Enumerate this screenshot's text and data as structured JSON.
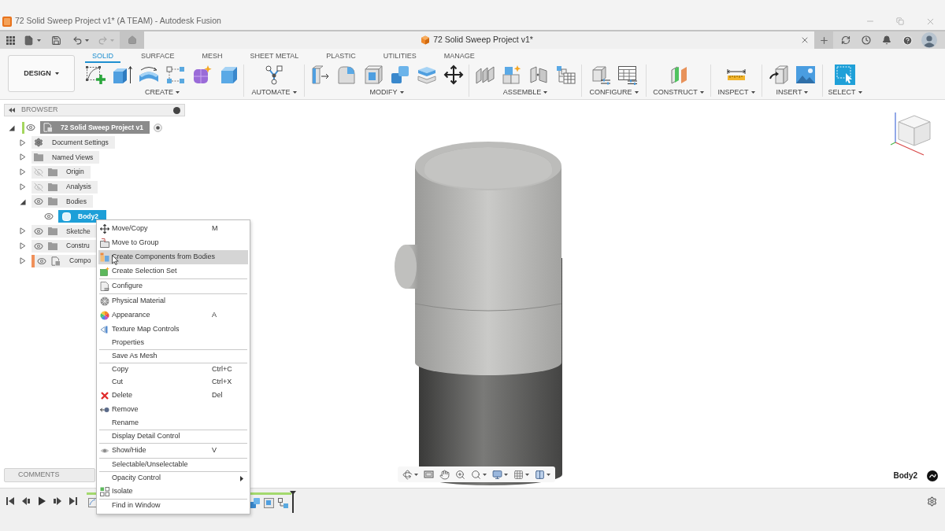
{
  "window": {
    "title": "72 Solid Sweep Project v1* (A TEAM) - Autodesk Fusion"
  },
  "quick_access": {
    "undo_disabled": false,
    "redo_disabled": true
  },
  "document_tab": {
    "title": "72 Solid Sweep Project v1*"
  },
  "toolbar": {
    "workspace": "DESIGN",
    "tabs": [
      {
        "label": "SOLID",
        "selected": true
      },
      {
        "label": "SURFACE",
        "selected": false
      },
      {
        "label": "MESH",
        "selected": false
      },
      {
        "label": "SHEET METAL",
        "selected": false
      },
      {
        "label": "PLASTIC",
        "selected": false
      },
      {
        "label": "UTILITIES",
        "selected": false
      },
      {
        "label": "MANAGE",
        "selected": false
      }
    ],
    "groups": [
      {
        "label": "CREATE"
      },
      {
        "label": "AUTOMATE"
      },
      {
        "label": "MODIFY"
      },
      {
        "label": "ASSEMBLE"
      },
      {
        "label": "CONFIGURE"
      },
      {
        "label": "CONSTRUCT"
      },
      {
        "label": "INSPECT"
      },
      {
        "label": "INSERT"
      },
      {
        "label": "SELECT"
      }
    ]
  },
  "browser": {
    "title": "BROWSER",
    "tree": [
      {
        "label": "72 Solid Sweep Project v1",
        "kind": "root",
        "visible": true,
        "expanded": true,
        "selected": false,
        "color": "#a4d65e",
        "children": [
          {
            "label": "Document Settings",
            "kind": "settings",
            "expanded": false,
            "selected": false
          },
          {
            "label": "Named Views",
            "kind": "folder",
            "expanded": false,
            "selected": false
          },
          {
            "label": "Origin",
            "kind": "folder",
            "visible": false,
            "expanded": false,
            "selected": false
          },
          {
            "label": "Analysis",
            "kind": "folder",
            "visible": false,
            "expanded": false,
            "selected": false
          },
          {
            "label": "Bodies",
            "kind": "folder",
            "visible": true,
            "expanded": true,
            "selected": false,
            "children": [
              {
                "label": "Body2",
                "kind": "body",
                "visible": true,
                "selected": true
              }
            ]
          },
          {
            "label": "Sketche",
            "kind": "folder",
            "visible": true,
            "expanded": false,
            "selected": false
          },
          {
            "label": "Constru",
            "kind": "folder",
            "visible": true,
            "expanded": false,
            "selected": false
          },
          {
            "label": "Compo",
            "kind": "component",
            "visible": true,
            "expanded": false,
            "selected": false,
            "color": "#f0905a"
          }
        ]
      }
    ]
  },
  "context_menu": {
    "sections": [
      [
        {
          "label": "Move/Copy",
          "shortcut": "M",
          "selected": false,
          "submenu": false
        },
        {
          "label": "Move to Group",
          "selected": false,
          "submenu": false
        },
        {
          "label": "Create Components from Bodies",
          "selected": true,
          "submenu": false
        },
        {
          "label": "Create Selection Set",
          "selected": false,
          "submenu": false
        }
      ],
      [
        {
          "label": "Configure",
          "selected": false,
          "submenu": false
        }
      ],
      [
        {
          "label": "Physical Material",
          "selected": false,
          "submenu": false
        },
        {
          "label": "Appearance",
          "shortcut": "A",
          "selected": false,
          "submenu": false
        },
        {
          "label": "Texture Map Controls",
          "selected": false,
          "submenu": false
        },
        {
          "label": "Properties",
          "selected": false,
          "submenu": false
        }
      ],
      [
        {
          "label": "Save As Mesh",
          "selected": false,
          "submenu": false
        }
      ],
      [
        {
          "label": "Copy",
          "shortcut": "Ctrl+C",
          "selected": false,
          "submenu": false
        },
        {
          "label": "Cut",
          "shortcut": "Ctrl+X",
          "selected": false,
          "submenu": false
        },
        {
          "label": "Delete",
          "shortcut": "Del",
          "selected": false,
          "submenu": false
        },
        {
          "label": "Remove",
          "selected": false,
          "submenu": false
        },
        {
          "label": "Rename",
          "selected": false,
          "submenu": false
        }
      ],
      [
        {
          "label": "Display Detail Control",
          "selected": false,
          "submenu": false
        }
      ],
      [
        {
          "label": "Show/Hide",
          "shortcut": "V",
          "selected": false,
          "submenu": false
        }
      ],
      [
        {
          "label": "Selectable/Unselectable",
          "selected": false,
          "submenu": false
        }
      ],
      [
        {
          "label": "Opacity Control",
          "selected": false,
          "submenu": true
        },
        {
          "label": "Isolate",
          "selected": false,
          "submenu": false
        }
      ],
      [
        {
          "label": "Find in Window",
          "selected": false,
          "submenu": false
        }
      ]
    ]
  },
  "comments": {
    "title": "COMMENTS"
  },
  "viewport": {
    "selection": "Body2"
  }
}
